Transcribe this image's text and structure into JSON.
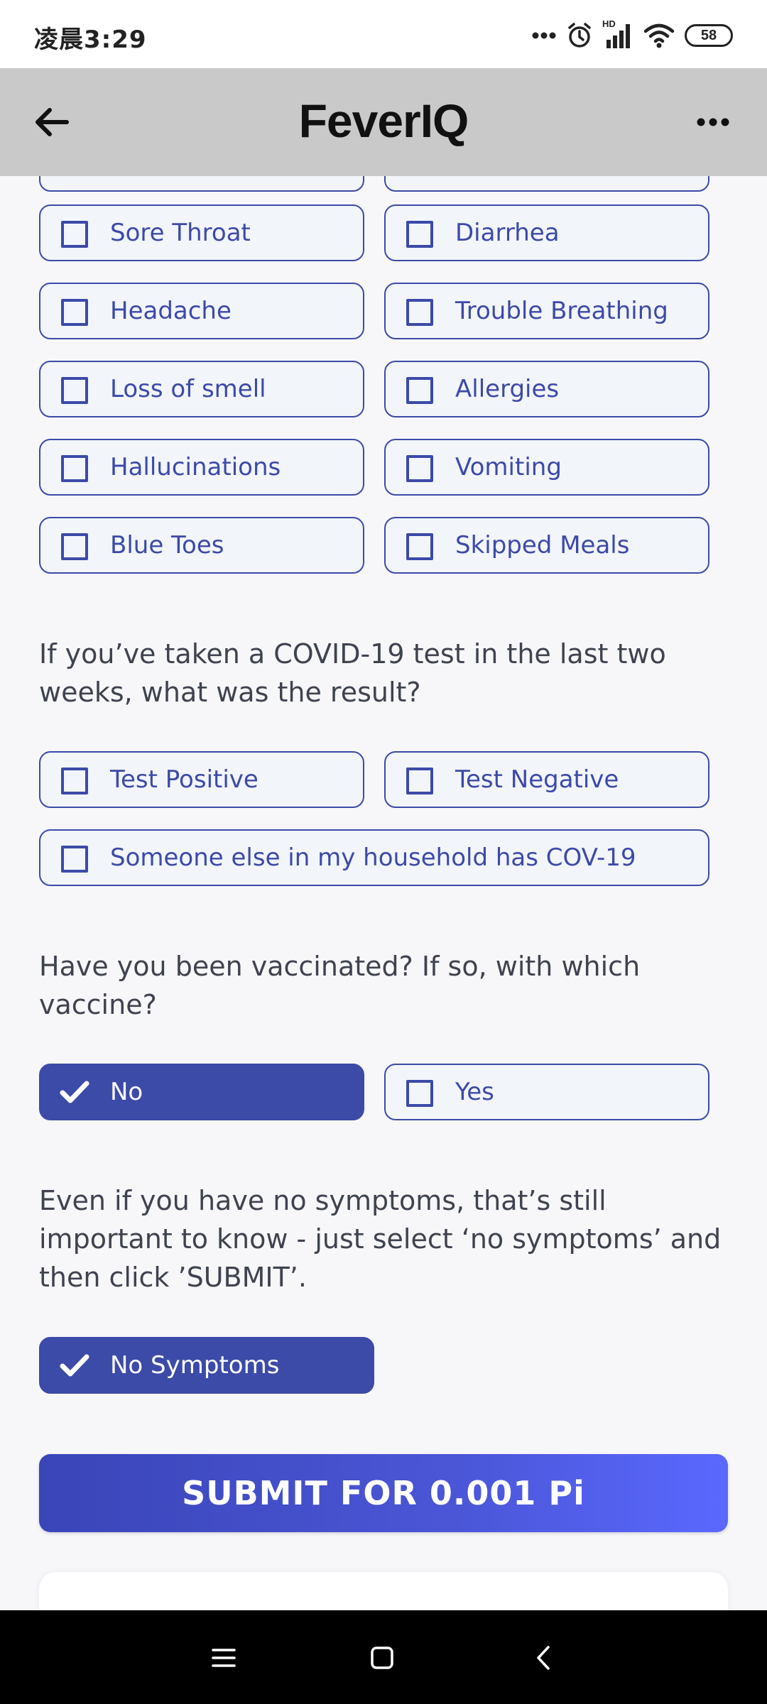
{
  "status_bar": {
    "time": "凌晨3:29",
    "battery": "58",
    "network": "HD"
  },
  "header": {
    "title": "FeverIQ"
  },
  "symptoms": [
    {
      "label": "Sore Throat",
      "checked": false
    },
    {
      "label": "Diarrhea",
      "checked": false
    },
    {
      "label": "Headache",
      "checked": false
    },
    {
      "label": "Trouble Breathing",
      "checked": false
    },
    {
      "label": "Loss of smell",
      "checked": false
    },
    {
      "label": "Allergies",
      "checked": false
    },
    {
      "label": "Hallucinations",
      "checked": false
    },
    {
      "label": "Vomiting",
      "checked": false
    },
    {
      "label": "Blue Toes",
      "checked": false
    },
    {
      "label": "Skipped Meals",
      "checked": false
    }
  ],
  "covid_test": {
    "question": "If you’ve taken a COVID-19 test in the last two weeks, what was the result?",
    "options": [
      {
        "label": "Test Positive",
        "checked": false
      },
      {
        "label": "Test Negative",
        "checked": false
      },
      {
        "label": "Someone else in my household has COV-19",
        "checked": false
      }
    ]
  },
  "vaccination": {
    "question": "Have you been vaccinated? If so, with which vaccine?",
    "options": [
      {
        "label": "No",
        "checked": true
      },
      {
        "label": "Yes",
        "checked": false
      }
    ]
  },
  "no_symptoms": {
    "text": "Even if you have no symptoms, that’s still important to know - just select ‘no symptoms’ and then click ’SUBMIT’.",
    "option": {
      "label": "No Symptoms",
      "checked": true
    }
  },
  "submit": {
    "label": "SUBMIT FOR 0.001 Pi"
  },
  "colors": {
    "accent": "#3c4aa8",
    "header_bg": "#c9c9c9",
    "page_bg": "#f7f7fa",
    "submit_gradient_end": "#5a68ff"
  }
}
